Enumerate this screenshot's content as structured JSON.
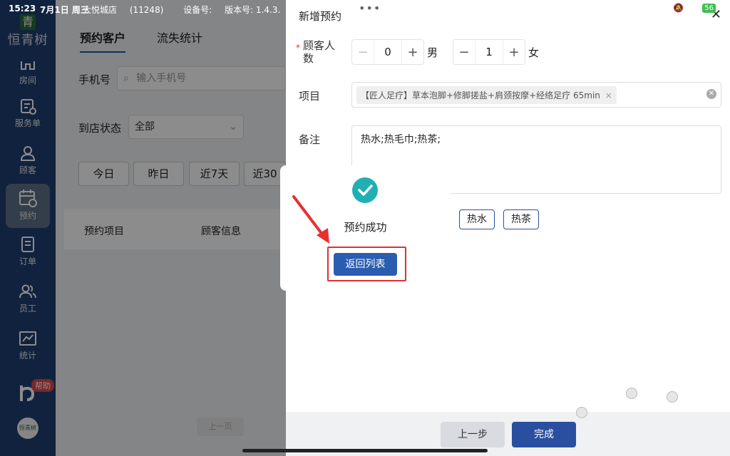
{
  "status_bar": {
    "time": "15:23",
    "date": "7月1日 周三",
    "battery": "56"
  },
  "top_info": {
    "store": "大悦城店",
    "store_id": "(11248)",
    "device": "设备号:",
    "version": "版本号: 1.4.3."
  },
  "sidebar": {
    "logo_mark": "青",
    "logo_name": "恒青树",
    "items": [
      {
        "label": "房间",
        "icon": "room-icon"
      },
      {
        "label": "服务单",
        "icon": "service-order-icon"
      },
      {
        "label": "顾客",
        "icon": "customer-icon"
      },
      {
        "label": "预约",
        "icon": "calendar-icon"
      },
      {
        "label": "订单",
        "icon": "order-icon"
      },
      {
        "label": "员工",
        "icon": "staff-icon"
      },
      {
        "label": "统计",
        "icon": "chart-icon"
      }
    ],
    "help_badge": "帮助",
    "avatar_text": "恒青树"
  },
  "main": {
    "tabs": [
      "预约客户",
      "流失统计"
    ],
    "phone_label": "手机号",
    "phone_placeholder": "输入手机号",
    "status_label": "到店状态",
    "status_value": "全部",
    "date_chips": [
      "今日",
      "昨日",
      "近7天",
      "近30"
    ],
    "table_headers": [
      "预约项目",
      "顾客信息"
    ],
    "pager_prev": "上一页"
  },
  "panel": {
    "title": "新增预约",
    "customer_count_label": "顾客人数",
    "required_mark": "*",
    "male": {
      "value": "0",
      "label": "男"
    },
    "female": {
      "value": "1",
      "label": "女"
    },
    "project_label": "项目",
    "project_tag": "【匠人足疗】草本泡脚+修脚搓盐+肩颈按摩+经络足疗 65min",
    "remark_label": "备注",
    "remark_value": "热水;热毛巾;热茶;",
    "quick_tags": [
      "热水",
      "热茶"
    ],
    "prev_button": "上一步",
    "done_button": "完成"
  },
  "modal": {
    "message": "预约成功",
    "confirm_button": "返回列表"
  },
  "colors": {
    "sidebar": "#1f3f73",
    "primary": "#2a4fa0",
    "success": "#20b0b4",
    "highlight": "#e03030"
  }
}
